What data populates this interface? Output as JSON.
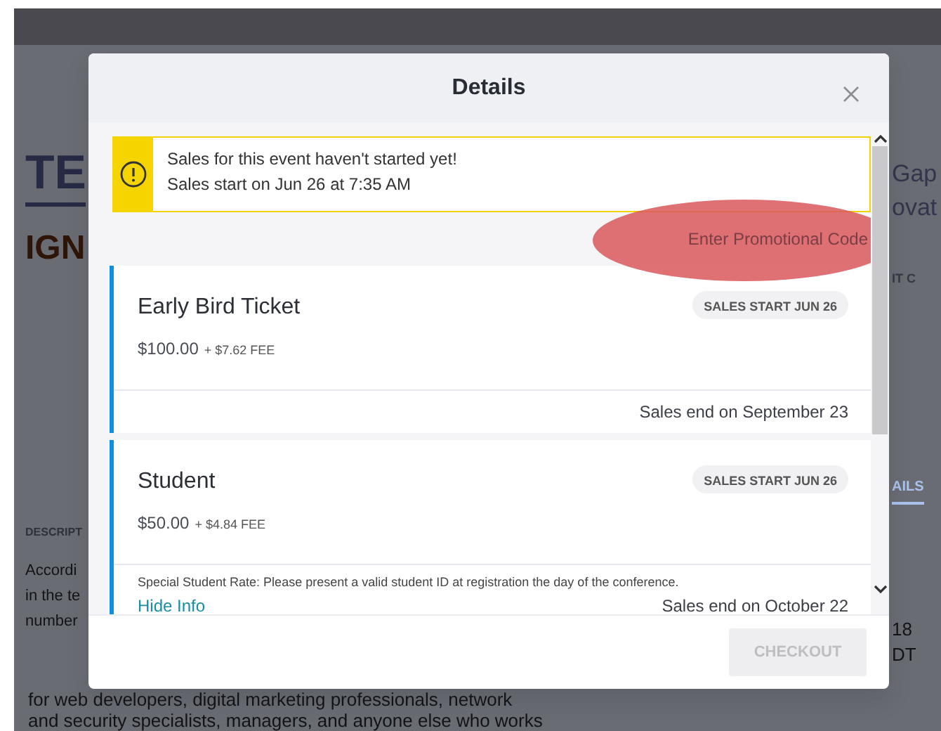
{
  "background": {
    "left": [
      {
        "kind": "title",
        "text": "TE"
      },
      {
        "kind": "subtitle",
        "text": "IGN"
      },
      {
        "kind": "heading",
        "text": "DESCRIPT"
      },
      {
        "kind": "body",
        "text": "Accordi"
      },
      {
        "kind": "body",
        "text": "in the te"
      },
      {
        "kind": "body",
        "text": "number"
      }
    ],
    "right": [
      {
        "kind": "title",
        "text": "Gap"
      },
      {
        "kind": "title",
        "text": "ovat"
      },
      {
        "kind": "small",
        "text": "IT C"
      },
      {
        "kind": "tab",
        "text": "AILS"
      },
      {
        "kind": "body",
        "text": "18"
      },
      {
        "kind": "body",
        "text": "DT"
      }
    ],
    "bottom_lines": [
      "for web developers, digital marketing professionals, network",
      "and security specialists, managers, and anyone else who works"
    ]
  },
  "modal": {
    "title": "Details",
    "alert": {
      "lines": [
        "Sales for this event haven't started yet!",
        "Sales start on Jun 26 at 7:35 AM"
      ]
    },
    "promo_link": "Enter Promotional Code",
    "tickets": [
      {
        "name": "Early Bird Ticket",
        "price": "$100.00",
        "fee": "+ $7.62 FEE",
        "badge": "SALES START JUN 26",
        "sales_end": "Sales end on September 23"
      },
      {
        "name": "Student",
        "price": "$50.00",
        "fee": "+ $4.84 FEE",
        "badge": "SALES START JUN 26",
        "info": "Special Student Rate: Please present a valid student ID at registration the day of the conference.",
        "info_link": "Hide Info",
        "sales_end": "Sales end on October 22"
      }
    ],
    "checkout": {
      "label": "CHECKOUT",
      "disabled": true
    }
  }
}
